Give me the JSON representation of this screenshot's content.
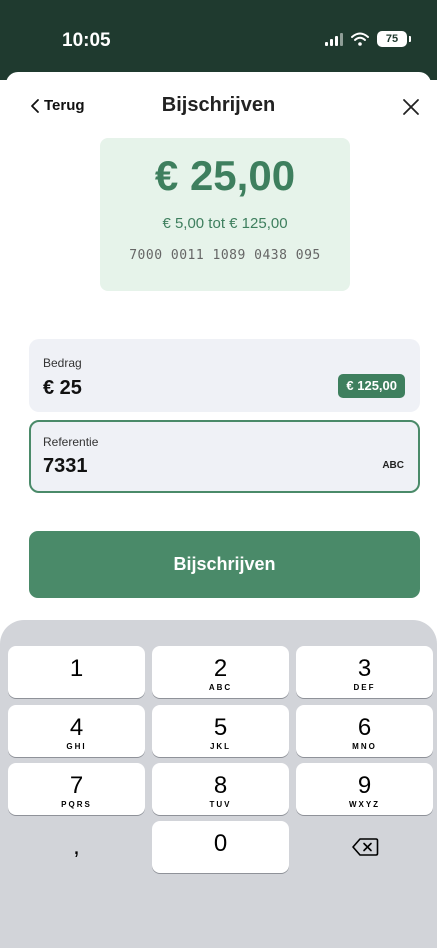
{
  "status_bar": {
    "time": "10:05",
    "battery": "75"
  },
  "header": {
    "back_label": "Terug",
    "title": "Bijschrijven"
  },
  "summary": {
    "amount": "€ 25,00",
    "range": "€ 5,00 tot € 125,00",
    "card_number": "7000 0011 1089 0438 095"
  },
  "amount_field": {
    "label": "Bedrag",
    "value": "€ 25",
    "max_badge": "€ 125,00"
  },
  "reference_field": {
    "label": "Referentie",
    "value": "7331",
    "keyboard_type": "ABC"
  },
  "submit_label": "Bijschrijven",
  "keypad": {
    "keys": [
      {
        "num": "1",
        "letters": ""
      },
      {
        "num": "2",
        "letters": "ABC"
      },
      {
        "num": "3",
        "letters": "DEF"
      },
      {
        "num": "4",
        "letters": "GHI"
      },
      {
        "num": "5",
        "letters": "JKL"
      },
      {
        "num": "6",
        "letters": "MNO"
      },
      {
        "num": "7",
        "letters": "PQRS"
      },
      {
        "num": "8",
        "letters": "TUV"
      },
      {
        "num": "9",
        "letters": "WXYZ"
      },
      {
        "num": ",",
        "letters": ""
      },
      {
        "num": "0",
        "letters": ""
      },
      {
        "num": "",
        "letters": "",
        "icon": "delete-icon"
      }
    ]
  },
  "colors": {
    "status_bar": "#1f3a2f",
    "brand_green": "#4a8a69",
    "card_background": "#e6f3ea",
    "field_background": "#eff1f6",
    "keypad_background": "#d2d4d9"
  }
}
